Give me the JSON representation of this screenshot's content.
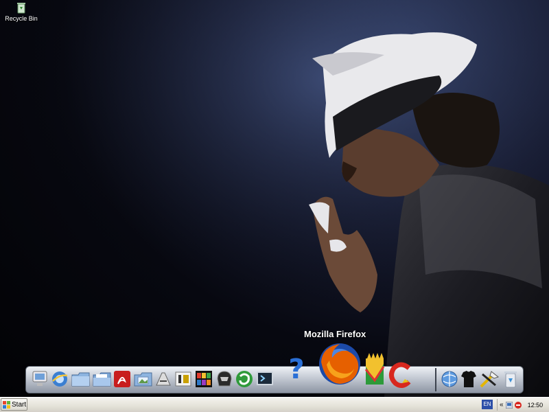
{
  "desktop": {
    "icons": [
      {
        "label": "Recycle Bin",
        "icon": "recycle-bin-icon"
      }
    ]
  },
  "dock": {
    "tooltip": "Mozilla Firefox",
    "items": [
      {
        "name": "my-computer-icon"
      },
      {
        "name": "internet-explorer-icon"
      },
      {
        "name": "folder-icon"
      },
      {
        "name": "documents-folder-icon"
      },
      {
        "name": "adobe-reader-icon"
      },
      {
        "name": "pictures-folder-icon"
      },
      {
        "name": "paint-icon"
      },
      {
        "name": "utility-icon"
      },
      {
        "name": "media-player-icon"
      },
      {
        "name": "helmet-icon"
      },
      {
        "name": "bittorrent-icon"
      },
      {
        "name": "terminal-icon"
      },
      {
        "name": "help-icon"
      },
      {
        "name": "mozilla-firefox-icon"
      },
      {
        "name": "avg-antivirus-icon"
      },
      {
        "name": "ccleaner-icon"
      },
      {
        "name": "web-browser-icon"
      },
      {
        "name": "jersey-icon"
      },
      {
        "name": "tools-icon"
      },
      {
        "name": "recycle-bin-icon"
      }
    ]
  },
  "taskbar": {
    "start_label": "Start",
    "language": "EN",
    "tray_arrow": "«",
    "tray_icons": [
      "network-icon",
      "security-stop-icon"
    ],
    "clock": "12:50"
  },
  "colors": {
    "taskbar": "#e4e2d8",
    "dock_shelf": "#c2c8d2",
    "firefox_orange": "#e66000",
    "firefox_blue": "#1c4aa8"
  }
}
